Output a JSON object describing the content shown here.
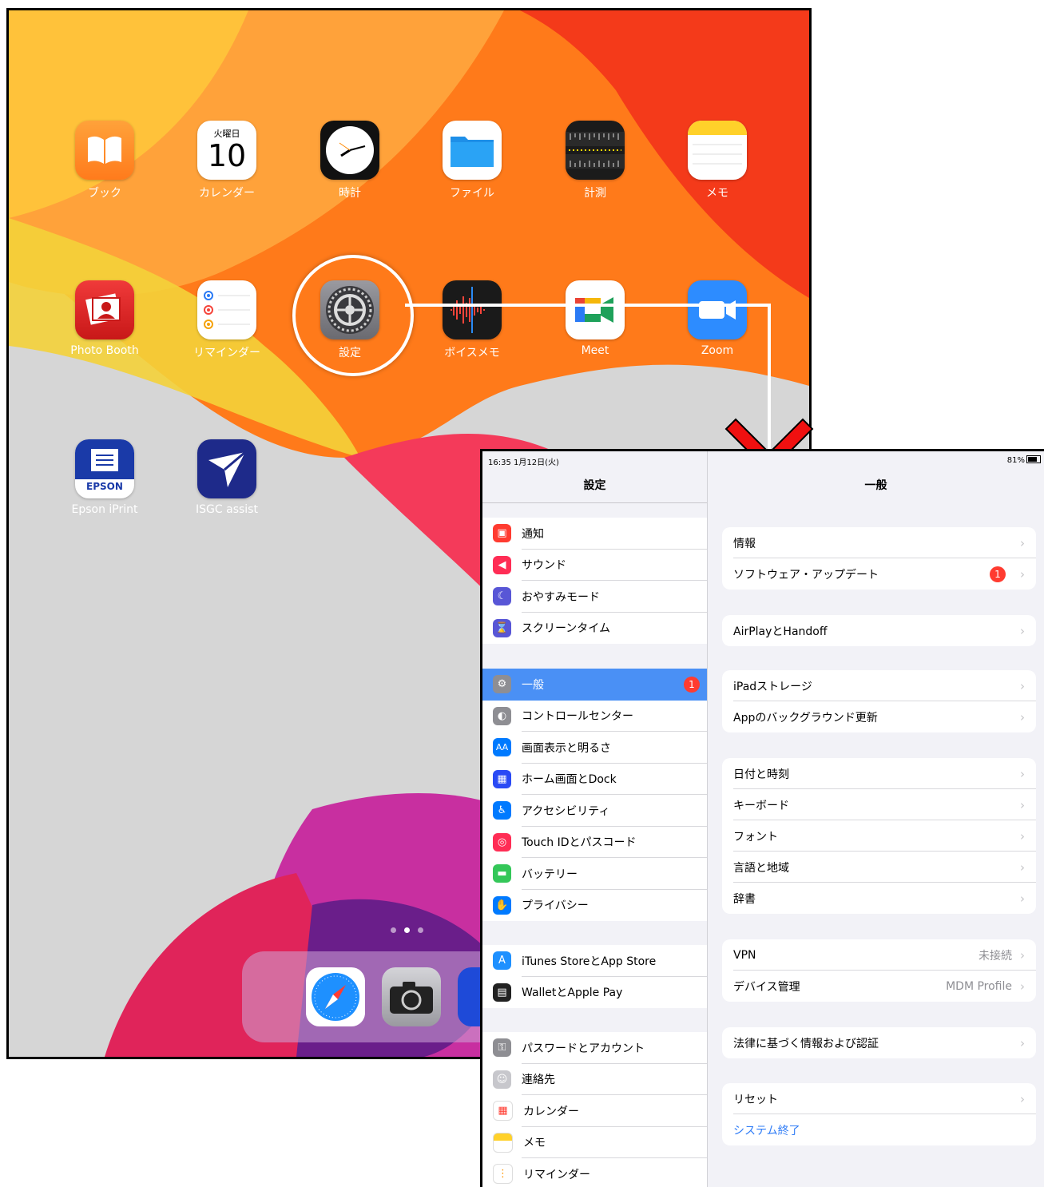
{
  "home": {
    "apps": [
      {
        "label": "ブック"
      },
      {
        "label": "カレンダー"
      },
      {
        "label": "時計"
      },
      {
        "label": "ファイル"
      },
      {
        "label": "計測"
      },
      {
        "label": "メモ"
      },
      {
        "label": "Photo Booth"
      },
      {
        "label": "リマインダー"
      },
      {
        "label": "設定"
      },
      {
        "label": "ボイスメモ"
      },
      {
        "label": "Meet"
      },
      {
        "label": "Zoom"
      },
      {
        "label": "Epson iPrint"
      },
      {
        "label": "ISGC assist"
      }
    ],
    "calendar_weekday": "火曜日",
    "calendar_day": "10",
    "epson_text": "EPSON"
  },
  "settings": {
    "status_time": "16:35 1月12日(火)",
    "battery": "81%",
    "sidebar_title": "設定",
    "sidebar_groups": [
      [
        "通知",
        "サウンド",
        "おやすみモード",
        "スクリーンタイム"
      ],
      [
        "一般",
        "コントロールセンター",
        "画面表示と明るさ",
        "ホーム画面とDock",
        "アクセシビリティ",
        "Touch IDとパスコード",
        "バッテリー",
        "プライバシー"
      ],
      [
        "iTunes StoreとApp Store",
        "WalletとApple Pay"
      ],
      [
        "パスワードとアカウント",
        "連絡先",
        "カレンダー",
        "メモ",
        "リマインダー"
      ]
    ],
    "general_badge": "1",
    "main_title": "一般",
    "main_groups": [
      [
        {
          "label": "情報"
        },
        {
          "label": "ソフトウェア・アップデート",
          "badge": "1"
        }
      ],
      [
        {
          "label": "AirPlayとHandoff"
        }
      ],
      [
        {
          "label": "iPadストレージ"
        },
        {
          "label": "Appのバックグラウンド更新"
        }
      ],
      [
        {
          "label": "日付と時刻"
        },
        {
          "label": "キーボード"
        },
        {
          "label": "フォント"
        },
        {
          "label": "言語と地域"
        },
        {
          "label": "辞書"
        }
      ],
      [
        {
          "label": "VPN",
          "value": "未接続"
        },
        {
          "label": "デバイス管理",
          "value": "MDM Profile"
        }
      ],
      [
        {
          "label": "法律に基づく情報および認証"
        }
      ],
      [
        {
          "label": "リセット"
        },
        {
          "label": "システム終了",
          "link": true
        }
      ]
    ]
  },
  "colors": {
    "accent": "#4a90f5",
    "badge": "#ff3b30",
    "link": "#2f7cf6"
  }
}
